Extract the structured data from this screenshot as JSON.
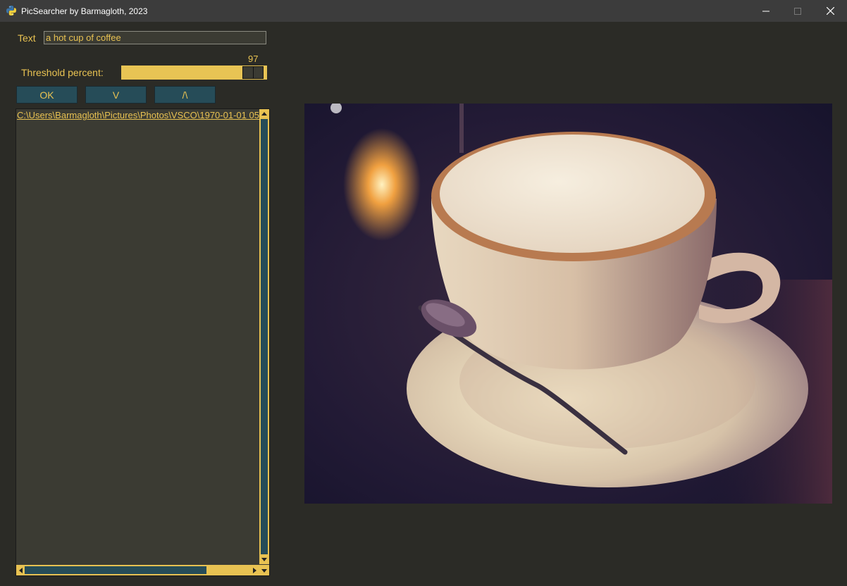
{
  "window": {
    "title": "PicSearcher by Barmagloth, 2023"
  },
  "search": {
    "label": "Text",
    "value": "a hot cup of coffee"
  },
  "threshold": {
    "label": "Threshold percent:",
    "value": 97
  },
  "buttons": {
    "ok": "OK",
    "down": "V",
    "up": "/\\"
  },
  "results": {
    "items": [
      "C:\\Users\\Barmagloth\\Pictures\\Photos\\VSCO\\1970-01-01 05"
    ]
  },
  "preview": {
    "icon": "coffee-photo"
  },
  "colors": {
    "accent": "#e8c252",
    "button_bg": "#264c58",
    "background": "#2b2b26",
    "field_bg": "#3b3b33"
  }
}
